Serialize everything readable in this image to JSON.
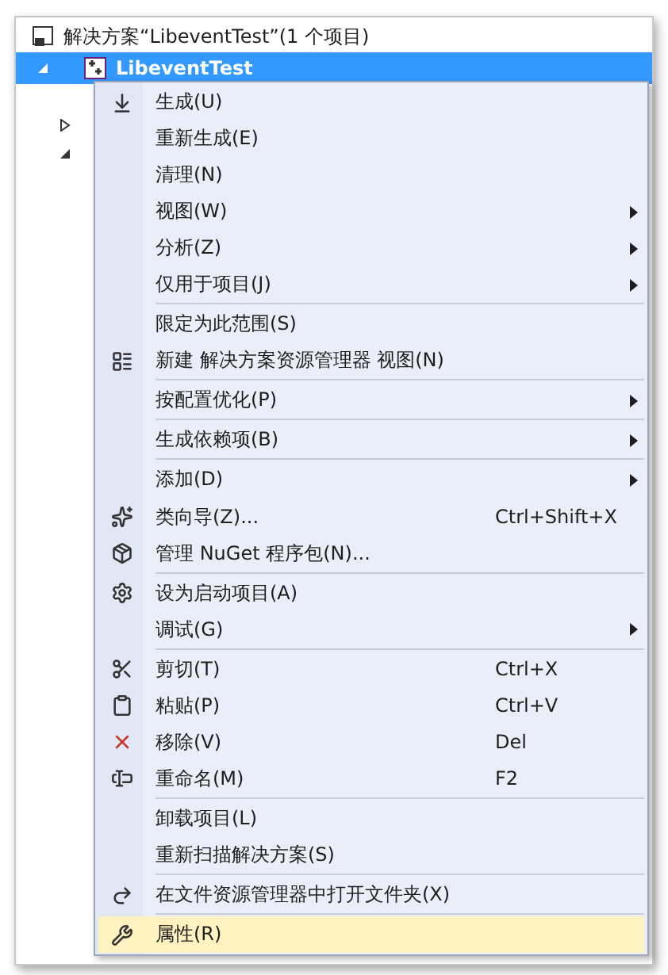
{
  "solution": {
    "label": "解决方案“LibeventTest”(1 个项目)"
  },
  "project": {
    "label": "LibeventTest",
    "selected": true,
    "expanded": true
  },
  "tree_nodes": [
    {
      "expanded": false
    },
    {
      "expanded": true
    }
  ],
  "context_menu": [
    {
      "kind": "item",
      "label": "生成(U)",
      "selected": false
    },
    {
      "kind": "item",
      "label": "重新生成(E)",
      "selected": false
    },
    {
      "kind": "item",
      "label": "清理(N)",
      "selected": false
    },
    {
      "kind": "item",
      "label": "视图(W)",
      "submenu": true,
      "selected": false
    },
    {
      "kind": "item",
      "label": "分析(Z)",
      "submenu": true,
      "selected": false
    },
    {
      "kind": "item",
      "label": "仅用于项目(J)",
      "submenu": true,
      "selected": false
    },
    {
      "kind": "separator"
    },
    {
      "kind": "item",
      "label": "限定为此范围(S)",
      "selected": false
    },
    {
      "kind": "item",
      "label": "新建 解决方案资源管理器 视图(N)",
      "selected": false
    },
    {
      "kind": "separator"
    },
    {
      "kind": "item",
      "label": "按配置优化(P)",
      "submenu": true,
      "selected": false
    },
    {
      "kind": "separator"
    },
    {
      "kind": "item",
      "label": "生成依赖项(B)",
      "submenu": true,
      "selected": false
    },
    {
      "kind": "separator"
    },
    {
      "kind": "item",
      "label": "添加(D)",
      "submenu": true,
      "selected": false
    },
    {
      "kind": "item",
      "label": "类向导(Z)...",
      "shortcut": "Ctrl+Shift+X",
      "selected": false
    },
    {
      "kind": "item",
      "label": "管理 NuGet 程序包(N)...",
      "selected": false
    },
    {
      "kind": "separator"
    },
    {
      "kind": "item",
      "label": "设为启动项目(A)",
      "selected": false
    },
    {
      "kind": "item",
      "label": "调试(G)",
      "submenu": true,
      "selected": false
    },
    {
      "kind": "separator"
    },
    {
      "kind": "item",
      "label": "剪切(T)",
      "shortcut": "Ctrl+X",
      "selected": false
    },
    {
      "kind": "item",
      "label": "粘贴(P)",
      "shortcut": "Ctrl+V",
      "selected": false
    },
    {
      "kind": "item",
      "label": "移除(V)",
      "shortcut": "Del",
      "selected": false
    },
    {
      "kind": "item",
      "label": "重命名(M)",
      "shortcut": "F2",
      "selected": false
    },
    {
      "kind": "separator"
    },
    {
      "kind": "item",
      "label": "卸载项目(L)",
      "selected": false
    },
    {
      "kind": "item",
      "label": "重新扫描解决方案(S)",
      "selected": false
    },
    {
      "kind": "separator"
    },
    {
      "kind": "item",
      "label": "在文件资源管理器中打开文件夹(X)",
      "selected": false
    },
    {
      "kind": "separator"
    },
    {
      "kind": "item",
      "label": "属性(R)",
      "selected": true
    }
  ]
}
